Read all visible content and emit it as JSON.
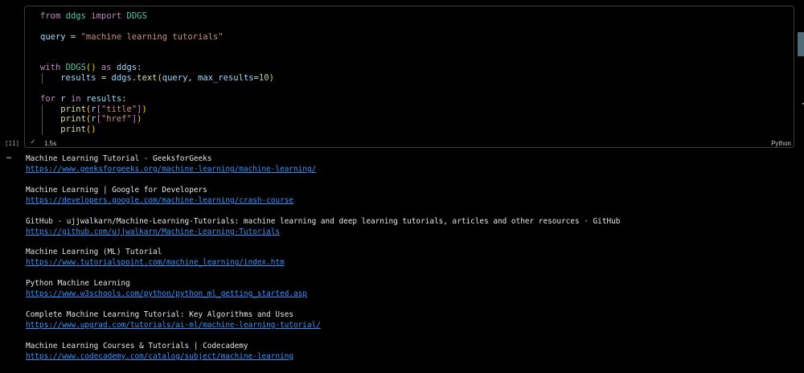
{
  "cell": {
    "code_lines": [
      [
        {
          "t": "from",
          "c": "kw"
        },
        {
          "t": " "
        },
        {
          "t": "ddgs",
          "c": "mod"
        },
        {
          "t": " "
        },
        {
          "t": "import",
          "c": "kw"
        },
        {
          "t": " "
        },
        {
          "t": "DDGS",
          "c": "mod"
        }
      ],
      [],
      [
        {
          "t": "query",
          "c": "var"
        },
        {
          "t": " = "
        },
        {
          "t": "\"machine learning tutorials\"",
          "c": "str"
        }
      ],
      [],
      [],
      [
        {
          "t": "with",
          "c": "kw"
        },
        {
          "t": " "
        },
        {
          "t": "DDGS",
          "c": "mod"
        },
        {
          "t": "()",
          "c": "bk1"
        },
        {
          "t": " "
        },
        {
          "t": "as",
          "c": "kw"
        },
        {
          "t": " "
        },
        {
          "t": "ddgs",
          "c": "var"
        },
        {
          "t": ":"
        }
      ],
      [
        {
          "t": "    "
        },
        {
          "t": "results",
          "c": "var"
        },
        {
          "t": " = "
        },
        {
          "t": "ddgs",
          "c": "var"
        },
        {
          "t": "."
        },
        {
          "t": "text",
          "c": "fn"
        },
        {
          "t": "(",
          "c": "bk1"
        },
        {
          "t": "query",
          "c": "var"
        },
        {
          "t": ", "
        },
        {
          "t": "max_results",
          "c": "var"
        },
        {
          "t": "="
        },
        {
          "t": "10",
          "c": "num"
        },
        {
          "t": ")",
          "c": "bk1"
        }
      ],
      [],
      [
        {
          "t": "for",
          "c": "kw"
        },
        {
          "t": " "
        },
        {
          "t": "r",
          "c": "var"
        },
        {
          "t": " "
        },
        {
          "t": "in",
          "c": "kw"
        },
        {
          "t": " "
        },
        {
          "t": "results",
          "c": "var"
        },
        {
          "t": ":"
        }
      ],
      [
        {
          "t": "    "
        },
        {
          "t": "print",
          "c": "fn"
        },
        {
          "t": "(",
          "c": "bk1"
        },
        {
          "t": "r",
          "c": "var"
        },
        {
          "t": "[",
          "c": "bk2"
        },
        {
          "t": "\"title\"",
          "c": "str"
        },
        {
          "t": "]",
          "c": "bk2"
        },
        {
          "t": ")",
          "c": "bk1"
        }
      ],
      [
        {
          "t": "    "
        },
        {
          "t": "print",
          "c": "fn"
        },
        {
          "t": "(",
          "c": "bk1"
        },
        {
          "t": "r",
          "c": "var"
        },
        {
          "t": "[",
          "c": "bk2"
        },
        {
          "t": "\"href\"",
          "c": "str"
        },
        {
          "t": "]",
          "c": "bk2"
        },
        {
          "t": ")",
          "c": "bk1"
        }
      ],
      [
        {
          "t": "    "
        },
        {
          "t": "print",
          "c": "fn"
        },
        {
          "t": "()",
          "c": "bk1"
        }
      ]
    ],
    "execution_count": "[11]",
    "status_icon": "check-icon",
    "duration": "1.5s",
    "language": "Python"
  },
  "output": {
    "more_icon": "ellipsis-icon",
    "results": [
      {
        "title": "Machine Learning Tutorial - GeeksforGeeks",
        "href": "https://www.geeksforgeeks.org/machine-learning/machine-learning/"
      },
      {
        "title": "Machine Learning | Google for Developers",
        "href": "https://developers.google.com/machine-learning/crash-course"
      },
      {
        "title": "GitHub - ujjwalkarn/Machine-Learning-Tutorials: machine learning and deep learning tutorials, articles and other resources · GitHub",
        "href": "https://github.com/ujjwalkarn/Machine-Learning-Tutorials"
      },
      {
        "title": "Machine Learning (ML) Tutorial",
        "href": "https://www.tutorialspoint.com/machine_learning/index.htm"
      },
      {
        "title": "Python Machine Learning",
        "href": "https://www.w3schools.com/python/python_ml_getting_started.asp"
      },
      {
        "title": "Complete Machine Learning Tutorial: Key Algorithms and Uses",
        "href": "https://www.upgrad.com/tutorials/ai-ml/machine-learning-tutorial/"
      },
      {
        "title": "Machine Learning Courses & Tutorials | Codecademy",
        "href": "https://www.codecademy.com/catalog/subject/machine-learning"
      }
    ]
  }
}
